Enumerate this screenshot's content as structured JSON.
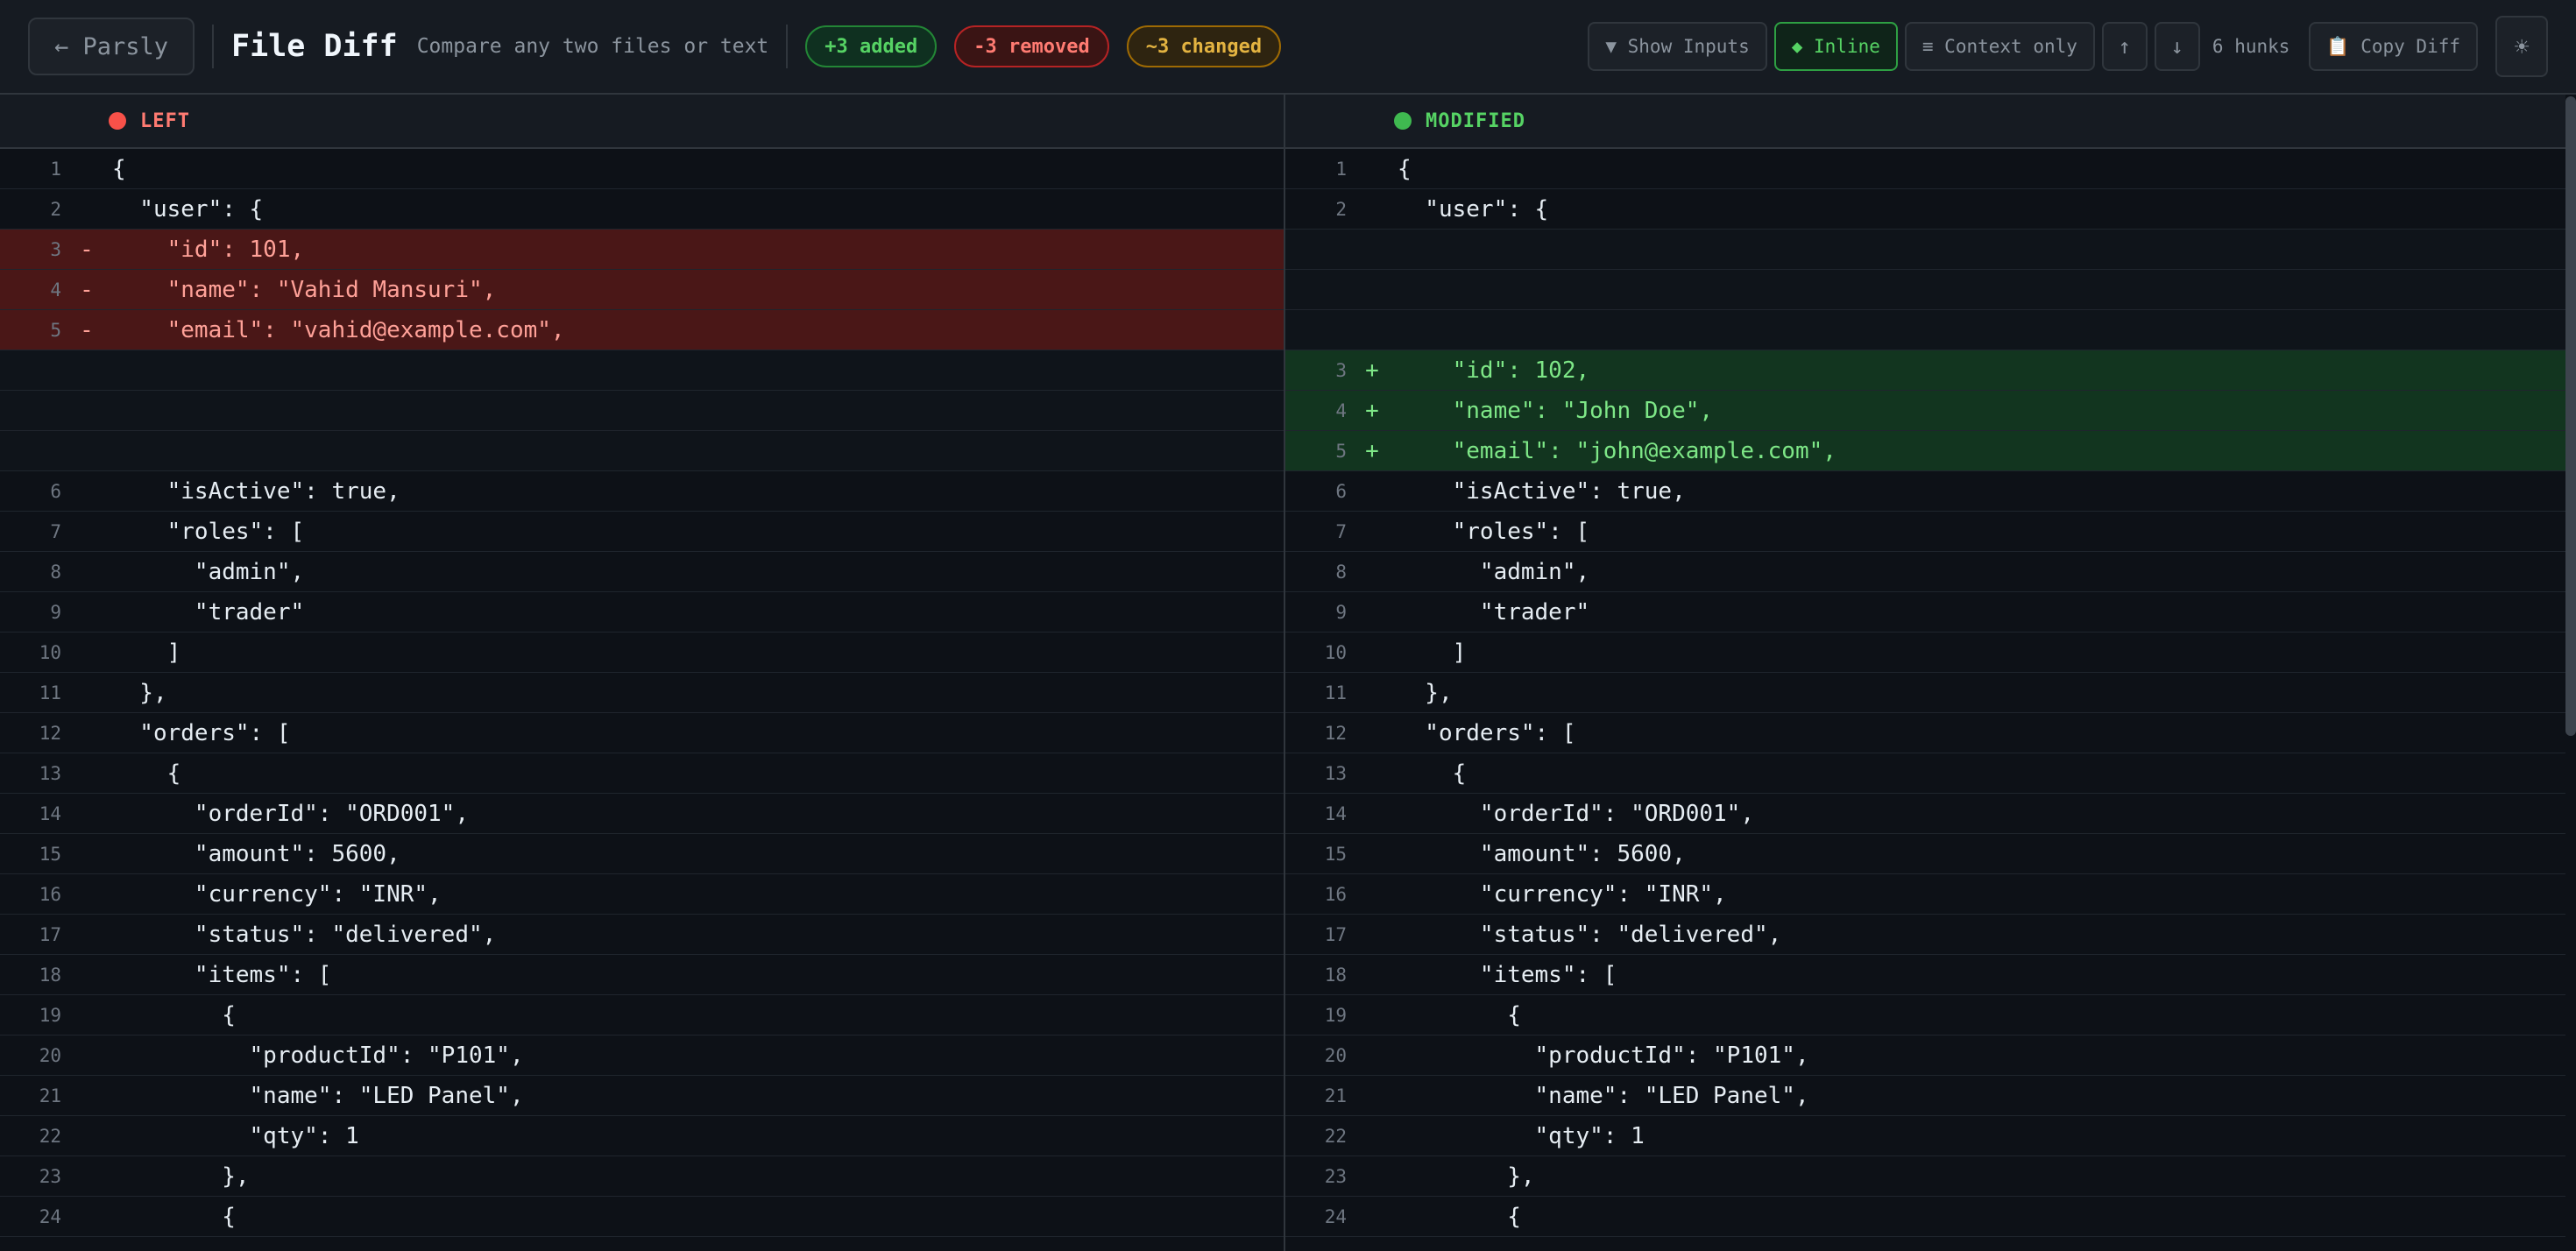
{
  "header": {
    "back_label": "← Parsly",
    "title": "File Diff",
    "subtitle": "Compare any two files or text",
    "badges": {
      "added": "+3 added",
      "removed": "-3 removed",
      "changed": "~3 changed"
    },
    "toolbar": {
      "show_inputs": "▼ Show Inputs",
      "inline": "◆ Inline",
      "context_only": "≡ Context only",
      "prev": "↑",
      "next": "↓",
      "hunks": "6 hunks",
      "copy_diff": "📋 Copy Diff",
      "theme": "☀"
    }
  },
  "left_pane": {
    "label": "LEFT",
    "rows": [
      {
        "type": "ctx",
        "ln": "1",
        "mark": "",
        "text": "{"
      },
      {
        "type": "ctx",
        "ln": "2",
        "mark": "",
        "text": "  \"user\": {"
      },
      {
        "type": "removed",
        "ln": "3",
        "mark": "-",
        "text": "    \"id\": 101,"
      },
      {
        "type": "removed",
        "ln": "4",
        "mark": "-",
        "text": "    \"name\": \"Vahid Mansuri\","
      },
      {
        "type": "removed",
        "ln": "5",
        "mark": "-",
        "text": "    \"email\": \"vahid@example.com\","
      },
      {
        "type": "empty",
        "ln": "",
        "mark": "",
        "text": ""
      },
      {
        "type": "empty",
        "ln": "",
        "mark": "",
        "text": ""
      },
      {
        "type": "empty",
        "ln": "",
        "mark": "",
        "text": ""
      },
      {
        "type": "ctx",
        "ln": "6",
        "mark": "",
        "text": "    \"isActive\": true,"
      },
      {
        "type": "ctx",
        "ln": "7",
        "mark": "",
        "text": "    \"roles\": ["
      },
      {
        "type": "ctx",
        "ln": "8",
        "mark": "",
        "text": "      \"admin\","
      },
      {
        "type": "ctx",
        "ln": "9",
        "mark": "",
        "text": "      \"trader\""
      },
      {
        "type": "ctx",
        "ln": "10",
        "mark": "",
        "text": "    ]"
      },
      {
        "type": "ctx",
        "ln": "11",
        "mark": "",
        "text": "  },"
      },
      {
        "type": "ctx",
        "ln": "12",
        "mark": "",
        "text": "  \"orders\": ["
      },
      {
        "type": "ctx",
        "ln": "13",
        "mark": "",
        "text": "    {"
      },
      {
        "type": "ctx",
        "ln": "14",
        "mark": "",
        "text": "      \"orderId\": \"ORD001\","
      },
      {
        "type": "ctx",
        "ln": "15",
        "mark": "",
        "text": "      \"amount\": 5600,"
      },
      {
        "type": "ctx",
        "ln": "16",
        "mark": "",
        "text": "      \"currency\": \"INR\","
      },
      {
        "type": "ctx",
        "ln": "17",
        "mark": "",
        "text": "      \"status\": \"delivered\","
      },
      {
        "type": "ctx",
        "ln": "18",
        "mark": "",
        "text": "      \"items\": ["
      },
      {
        "type": "ctx",
        "ln": "19",
        "mark": "",
        "text": "        {"
      },
      {
        "type": "ctx",
        "ln": "20",
        "mark": "",
        "text": "          \"productId\": \"P101\","
      },
      {
        "type": "ctx",
        "ln": "21",
        "mark": "",
        "text": "          \"name\": \"LED Panel\","
      },
      {
        "type": "ctx",
        "ln": "22",
        "mark": "",
        "text": "          \"qty\": 1"
      },
      {
        "type": "ctx",
        "ln": "23",
        "mark": "",
        "text": "        },"
      },
      {
        "type": "ctx",
        "ln": "24",
        "mark": "",
        "text": "        {"
      }
    ]
  },
  "right_pane": {
    "label": "MODIFIED",
    "rows": [
      {
        "type": "ctx",
        "ln": "1",
        "mark": "",
        "text": "{"
      },
      {
        "type": "ctx",
        "ln": "2",
        "mark": "",
        "text": "  \"user\": {"
      },
      {
        "type": "empty",
        "ln": "",
        "mark": "",
        "text": ""
      },
      {
        "type": "empty",
        "ln": "",
        "mark": "",
        "text": ""
      },
      {
        "type": "empty",
        "ln": "",
        "mark": "",
        "text": ""
      },
      {
        "type": "added",
        "ln": "3",
        "mark": "+",
        "text": "    \"id\": 102,"
      },
      {
        "type": "added",
        "ln": "4",
        "mark": "+",
        "text": "    \"name\": \"John Doe\","
      },
      {
        "type": "added",
        "ln": "5",
        "mark": "+",
        "text": "    \"email\": \"john@example.com\","
      },
      {
        "type": "ctx",
        "ln": "6",
        "mark": "",
        "text": "    \"isActive\": true,"
      },
      {
        "type": "ctx",
        "ln": "7",
        "mark": "",
        "text": "    \"roles\": ["
      },
      {
        "type": "ctx",
        "ln": "8",
        "mark": "",
        "text": "      \"admin\","
      },
      {
        "type": "ctx",
        "ln": "9",
        "mark": "",
        "text": "      \"trader\""
      },
      {
        "type": "ctx",
        "ln": "10",
        "mark": "",
        "text": "    ]"
      },
      {
        "type": "ctx",
        "ln": "11",
        "mark": "",
        "text": "  },"
      },
      {
        "type": "ctx",
        "ln": "12",
        "mark": "",
        "text": "  \"orders\": ["
      },
      {
        "type": "ctx",
        "ln": "13",
        "mark": "",
        "text": "    {"
      },
      {
        "type": "ctx",
        "ln": "14",
        "mark": "",
        "text": "      \"orderId\": \"ORD001\","
      },
      {
        "type": "ctx",
        "ln": "15",
        "mark": "",
        "text": "      \"amount\": 5600,"
      },
      {
        "type": "ctx",
        "ln": "16",
        "mark": "",
        "text": "      \"currency\": \"INR\","
      },
      {
        "type": "ctx",
        "ln": "17",
        "mark": "",
        "text": "      \"status\": \"delivered\","
      },
      {
        "type": "ctx",
        "ln": "18",
        "mark": "",
        "text": "      \"items\": ["
      },
      {
        "type": "ctx",
        "ln": "19",
        "mark": "",
        "text": "        {"
      },
      {
        "type": "ctx",
        "ln": "20",
        "mark": "",
        "text": "          \"productId\": \"P101\","
      },
      {
        "type": "ctx",
        "ln": "21",
        "mark": "",
        "text": "          \"name\": \"LED Panel\","
      },
      {
        "type": "ctx",
        "ln": "22",
        "mark": "",
        "text": "          \"qty\": 1"
      },
      {
        "type": "ctx",
        "ln": "23",
        "mark": "",
        "text": "        },"
      },
      {
        "type": "ctx",
        "ln": "24",
        "mark": "",
        "text": "        {"
      }
    ]
  }
}
